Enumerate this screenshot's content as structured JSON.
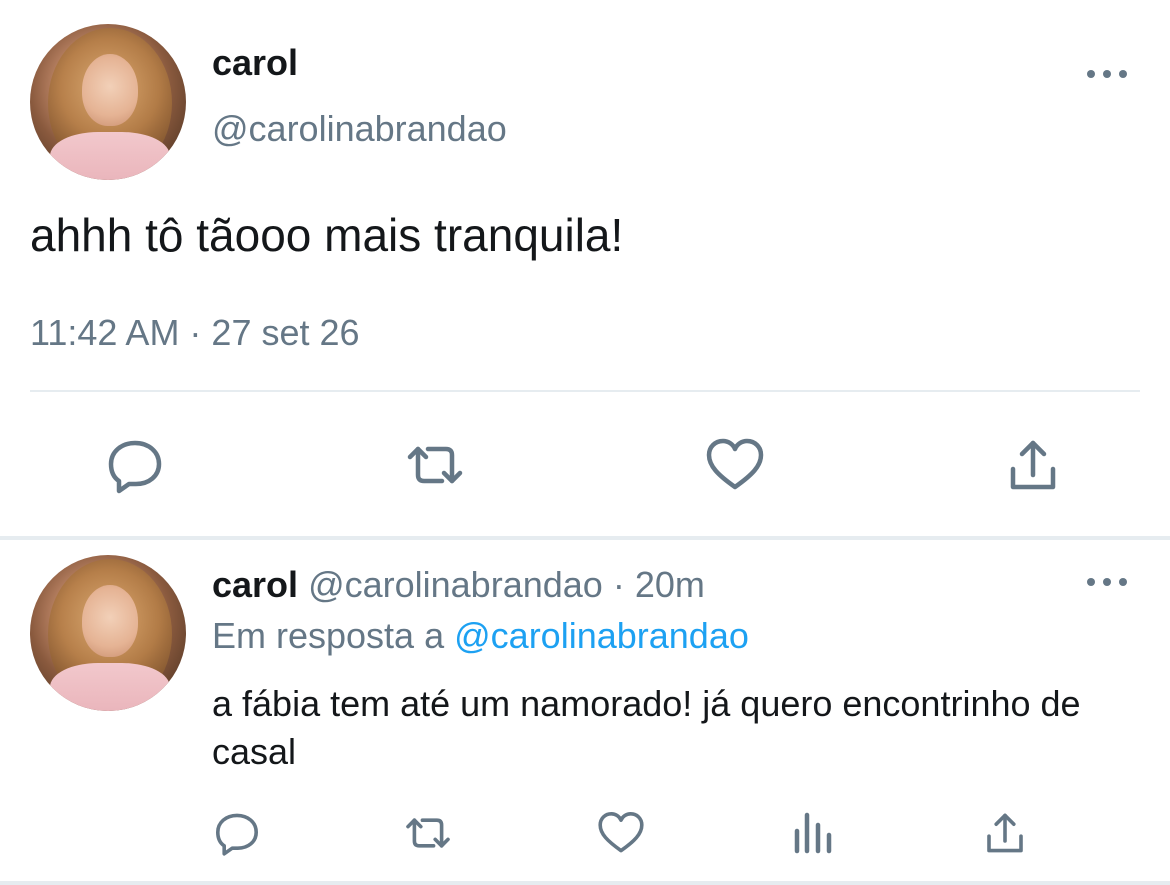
{
  "main_tweet": {
    "author_name": "carol",
    "author_handle": "@carolinabrandao",
    "text": "ahhh tô tãooo mais tranquila!",
    "timestamp": "11:42 AM · 27 set 26",
    "actions": [
      "reply-icon",
      "retweet-icon",
      "like-icon",
      "share-icon"
    ]
  },
  "reply_tweet": {
    "author_name": "carol",
    "author_handle": "@carolinabrandao",
    "separator": "·",
    "age": "20m",
    "reply_prefix": "Em resposta a",
    "reply_mention": "@carolinabrandao",
    "text": "a fábia tem até um namorado! já quero encontrinho de casal",
    "actions": [
      "reply-icon",
      "retweet-icon",
      "like-icon",
      "analytics-icon",
      "share-icon"
    ]
  },
  "colors": {
    "primary_text": "#14171a",
    "secondary_text": "#657786",
    "link": "#1da1f2",
    "divider": "#e6ecf0"
  }
}
